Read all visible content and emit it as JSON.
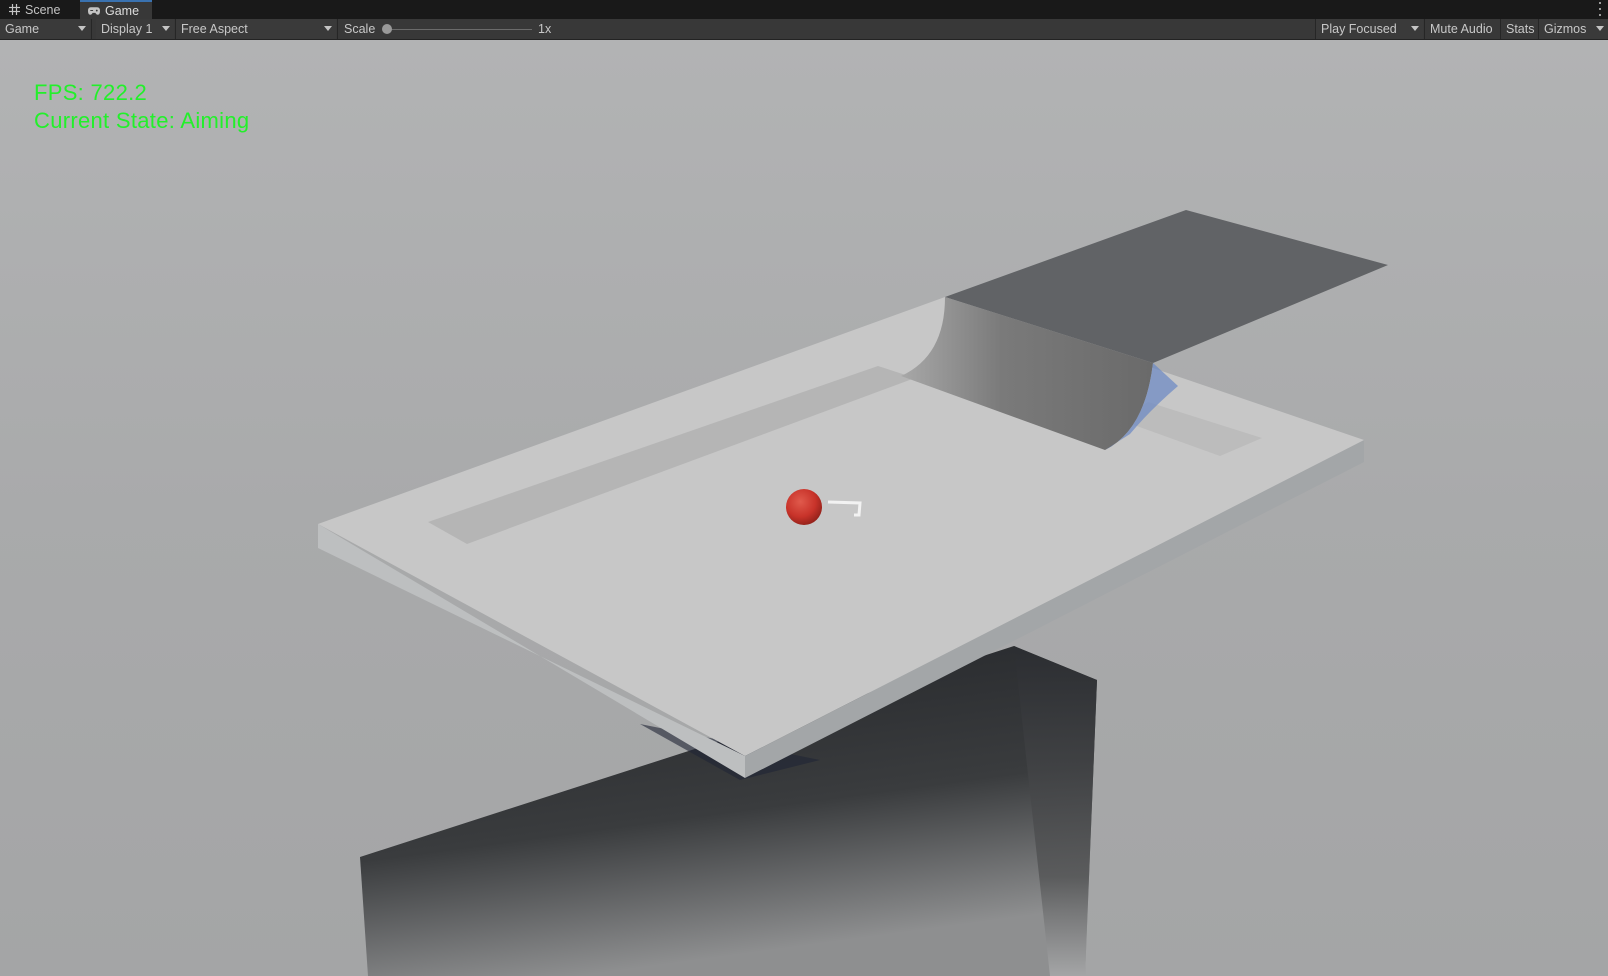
{
  "tabs": [
    {
      "label": "Scene",
      "icon": "grid-icon",
      "active": false
    },
    {
      "label": "Game",
      "icon": "gamepad-icon",
      "active": true
    }
  ],
  "toolbar": {
    "view_mode": "Game",
    "display": "Display 1",
    "aspect": "Free Aspect",
    "scale_label": "Scale",
    "scale_value": "1x",
    "scale_level": 0,
    "play_mode": "Play Focused",
    "mute_audio": "Mute Audio",
    "stats": "Stats",
    "gizmos": "Gizmos"
  },
  "hud": {
    "fps": "FPS: 722.2",
    "state": "Current State: Aiming"
  },
  "colors": {
    "hud_text": "#22f02a",
    "ball": "#c8332a",
    "sky": "#b3b4b5",
    "tab_accent": "#3a72b0"
  }
}
